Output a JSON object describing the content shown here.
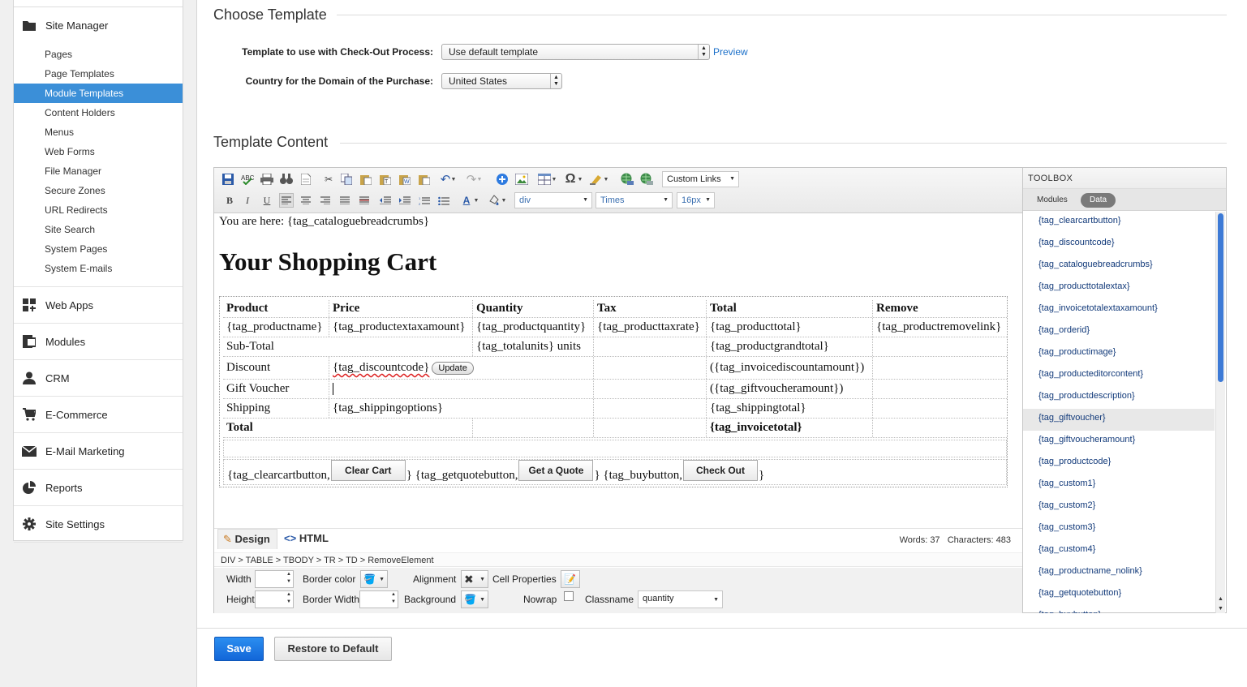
{
  "sidebar": {
    "sections": [
      {
        "label": "Site Manager",
        "icon": "folder-icon"
      },
      {
        "label": "Web Apps",
        "icon": "grid-icon"
      },
      {
        "label": "Modules",
        "icon": "module-icon"
      },
      {
        "label": "CRM",
        "icon": "person-icon"
      },
      {
        "label": "E-Commerce",
        "icon": "cart-icon"
      },
      {
        "label": "E-Mail Marketing",
        "icon": "envelope-icon"
      },
      {
        "label": "Reports",
        "icon": "pie-chart-icon"
      },
      {
        "label": "Site Settings",
        "icon": "gear-icon"
      }
    ],
    "site_manager_items": [
      "Pages",
      "Page Templates",
      "Module Templates",
      "Content Holders",
      "Menus",
      "Web Forms",
      "File Manager",
      "Secure Zones",
      "URL Redirects",
      "Site Search",
      "System Pages",
      "System E-mails"
    ],
    "active_item": "Module Templates"
  },
  "choose_template": {
    "title": "Choose Template",
    "template_label": "Template to use with Check-Out Process:",
    "template_value": "Use default template",
    "preview_link": "Preview",
    "country_label": "Country for the Domain of the Purchase:",
    "country_value": "United States"
  },
  "template_content": {
    "title": "Template Content"
  },
  "toolbar": {
    "custom_links": "Custom Links",
    "block_format": "div",
    "font_family": "Times",
    "font_size": "16px"
  },
  "document": {
    "breadcrumbs": "You are here: {tag_cataloguebreadcrumbs}",
    "heading": "Your Shopping Cart",
    "table": {
      "headers": [
        "Product",
        "Price",
        "Quantity",
        "Tax",
        "Total",
        "Remove"
      ],
      "row1": [
        "{tag_productname}",
        "{tag_productextaxamount}",
        "{tag_productquantity}",
        "{tag_producttaxrate}",
        "{tag_producttotal}",
        "{tag_productremovelink}"
      ],
      "subtotal": {
        "label": "Sub-Total",
        "quantity": "{tag_totalunits} units",
        "total": "{tag_productgrandtotal}"
      },
      "discount": {
        "label": "Discount",
        "code": "{tag_discountcode}",
        "button": "Update",
        "total": "({tag_invoicediscountamount})"
      },
      "gift": {
        "label": "Gift Voucher",
        "total": "({tag_giftvoucheramount})"
      },
      "shipping": {
        "label": "Shipping",
        "options": "{tag_shippingoptions}",
        "total": "{tag_shippingtotal}"
      },
      "total": {
        "label": "Total",
        "value": "{tag_invoicetotal}"
      },
      "buttons": {
        "clear_pre": "{tag_clearcartbutton,",
        "clear_btn": "Clear Cart",
        "quote_pre": "} {tag_getquotebutton,",
        "quote_btn": "Get a Quote",
        "buy_pre": "} {tag_buybutton,",
        "buy_btn": "Check Out",
        "end": "}"
      }
    }
  },
  "modes": {
    "design": "Design",
    "html": "HTML"
  },
  "word_count": "Words: 37   Characters: 483",
  "element_path": "DIV > TABLE > TBODY > TR > TD > RemoveElement",
  "properties": {
    "width": "Width",
    "height": "Height",
    "border_color": "Border color",
    "border_width": "Border Width",
    "alignment": "Alignment",
    "background": "Background",
    "cell_properties": "Cell Properties",
    "nowrap": "Nowrap",
    "classname": "Classname",
    "classname_value": "quantity"
  },
  "toolbox": {
    "title": "TOOLBOX",
    "tabs": [
      "Modules",
      "Data"
    ],
    "active_tab": "Data",
    "tags": [
      "{tag_clearcartbutton}",
      "{tag_discountcode}",
      "{tag_cataloguebreadcrumbs}",
      "{tag_producttotalextax}",
      "{tag_invoicetotalextaxamount}",
      "{tag_orderid}",
      "{tag_productimage}",
      "{tag_producteditorcontent}",
      "{tag_productdescription}",
      "{tag_giftvoucher}",
      "{tag_giftvoucheramount}",
      "{tag_productcode}",
      "{tag_custom1}",
      "{tag_custom2}",
      "{tag_custom3}",
      "{tag_custom4}",
      "{tag_productname_nolink}",
      "{tag_getquotebutton}",
      "{tag_buybutton}"
    ],
    "highlighted": "{tag_giftvoucher}"
  },
  "actions": {
    "save": "Save",
    "restore": "Restore to Default"
  },
  "colors": {
    "accent": "#3b8fd8",
    "save": "#1a7ae6",
    "link": "#1a6fc9"
  }
}
